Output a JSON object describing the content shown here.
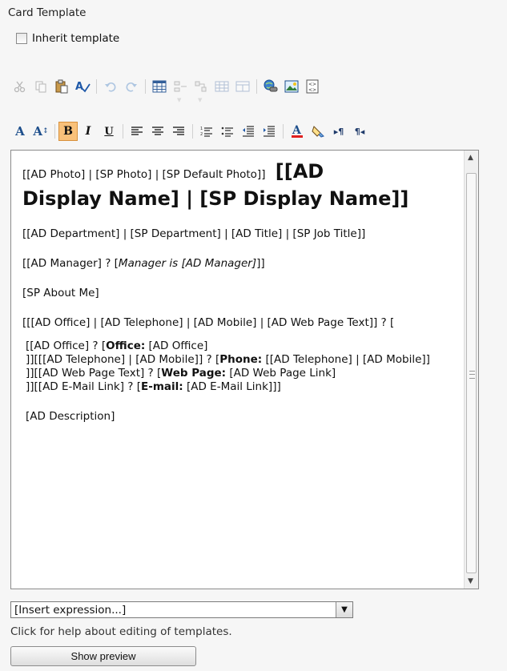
{
  "section_title": "Card Template",
  "inherit": {
    "label": "Inherit template",
    "checked": false
  },
  "toolbar1": [
    {
      "name": "cut-icon",
      "enabled": false
    },
    {
      "name": "copy-icon",
      "enabled": false
    },
    {
      "name": "paste-icon",
      "enabled": true
    },
    {
      "name": "spelling-icon",
      "enabled": true
    },
    {
      "name": "undo-icon",
      "enabled": false
    },
    {
      "name": "redo-icon",
      "enabled": false
    },
    {
      "name": "insert-table-icon",
      "enabled": true
    },
    {
      "name": "insert-row-icon",
      "enabled": false
    },
    {
      "name": "insert-column-icon",
      "enabled": false
    },
    {
      "name": "merge-cells-icon",
      "enabled": false
    },
    {
      "name": "split-cells-icon",
      "enabled": false
    },
    {
      "name": "hyperlink-icon",
      "enabled": true
    },
    {
      "name": "image-icon",
      "enabled": true
    },
    {
      "name": "html-source-icon",
      "enabled": true
    }
  ],
  "toolbar2": [
    {
      "name": "font-icon",
      "label": "A"
    },
    {
      "name": "font-size-icon",
      "label": "A"
    },
    {
      "name": "bold-icon",
      "label": "B",
      "active": true
    },
    {
      "name": "italic-icon",
      "label": "I"
    },
    {
      "name": "underline-icon",
      "label": "U"
    },
    {
      "name": "align-left-icon",
      "label": "≡"
    },
    {
      "name": "align-center-icon",
      "label": "≡"
    },
    {
      "name": "align-right-icon",
      "label": "≡"
    },
    {
      "name": "numbered-list-icon",
      "label": "☰"
    },
    {
      "name": "bullet-list-icon",
      "label": "☰"
    },
    {
      "name": "decrease-indent-icon",
      "label": "⇤"
    },
    {
      "name": "increase-indent-icon",
      "label": "⇥"
    },
    {
      "name": "font-color-icon",
      "label": "A"
    },
    {
      "name": "highlight-icon",
      "label": "✎"
    },
    {
      "name": "ltr-icon",
      "label": "▸¶"
    },
    {
      "name": "rtl-icon",
      "label": "¶◂"
    }
  ],
  "editor": {
    "line1": "[[AD Photo] | [SP Photo] | [SP Default Photo]]",
    "line1_heading": "[[AD",
    "heading_rest": "Display Name] | [SP Display Name]]",
    "dept": "[[AD Department] | [SP Department] | [AD Title] | [SP Job Title]]",
    "manager_prefix": "[[AD Manager] ? [",
    "manager_italic": "Manager is [AD Manager]",
    "manager_suffix": "]]",
    "about": "[SP About Me]",
    "office_line": "[[[AD Office] | [AD Telephone] | [AD Mobile] | [AD Web Page Text]] ? [",
    "office_detail_1a": "[[AD Office] ? [",
    "office_detail_1b": "Office:",
    "office_detail_1c": " [AD Office]",
    "office_detail_2a": "]][[[AD Telephone] | [AD Mobile]] ? [",
    "office_detail_2b": "Phone:",
    "office_detail_2c": " [[AD Telephone] | [AD Mobile]]",
    "office_detail_3a": "]][[AD Web Page Text] ? [",
    "office_detail_3b": "Web Page:",
    "office_detail_3c": " [AD Web Page Link]",
    "office_detail_4a": "]][[AD E-Mail Link] ? [",
    "office_detail_4b": "E-mail:",
    "office_detail_4c": " [AD E-Mail Link]]]",
    "description": "[AD Description]"
  },
  "insert_expression": {
    "selected": "[Insert expression...]"
  },
  "help_text": "Click for help about editing of templates.",
  "preview_button": "Show preview"
}
